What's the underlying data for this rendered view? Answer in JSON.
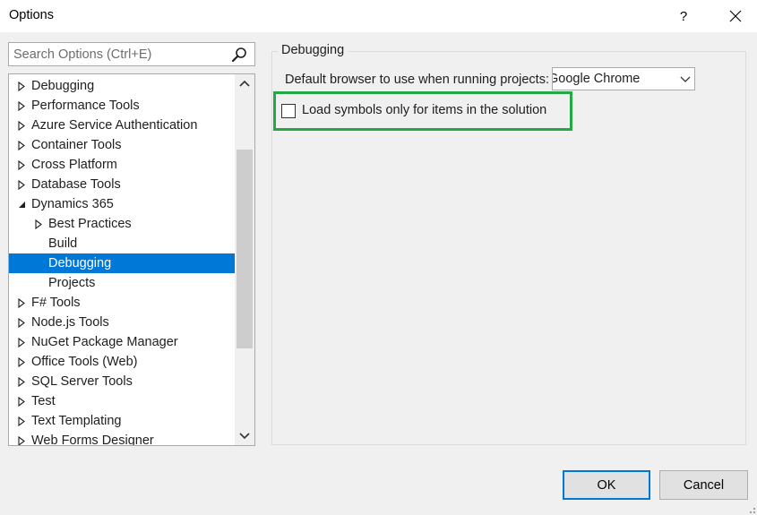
{
  "window": {
    "title": "Options",
    "help_label": "?"
  },
  "search": {
    "placeholder": "Search Options (Ctrl+E)",
    "icon": "magnifier-icon"
  },
  "tree": {
    "items": [
      {
        "label": "Debugging",
        "indent": 0,
        "arrow": "collapsed",
        "selected": false
      },
      {
        "label": "Performance Tools",
        "indent": 0,
        "arrow": "collapsed",
        "selected": false
      },
      {
        "label": "Azure Service Authentication",
        "indent": 0,
        "arrow": "collapsed",
        "selected": false
      },
      {
        "label": "Container Tools",
        "indent": 0,
        "arrow": "collapsed",
        "selected": false
      },
      {
        "label": "Cross Platform",
        "indent": 0,
        "arrow": "collapsed",
        "selected": false
      },
      {
        "label": "Database Tools",
        "indent": 0,
        "arrow": "collapsed",
        "selected": false
      },
      {
        "label": "Dynamics 365",
        "indent": 0,
        "arrow": "expanded",
        "selected": false
      },
      {
        "label": "Best Practices",
        "indent": 1,
        "arrow": "collapsed",
        "selected": false
      },
      {
        "label": "Build",
        "indent": 1,
        "arrow": "none",
        "selected": false
      },
      {
        "label": "Debugging",
        "indent": 1,
        "arrow": "none",
        "selected": true
      },
      {
        "label": "Projects",
        "indent": 1,
        "arrow": "none",
        "selected": false
      },
      {
        "label": "F# Tools",
        "indent": 0,
        "arrow": "collapsed",
        "selected": false
      },
      {
        "label": "Node.js Tools",
        "indent": 0,
        "arrow": "collapsed",
        "selected": false
      },
      {
        "label": "NuGet Package Manager",
        "indent": 0,
        "arrow": "collapsed",
        "selected": false
      },
      {
        "label": "Office Tools (Web)",
        "indent": 0,
        "arrow": "collapsed",
        "selected": false
      },
      {
        "label": "SQL Server Tools",
        "indent": 0,
        "arrow": "collapsed",
        "selected": false
      },
      {
        "label": "Test",
        "indent": 0,
        "arrow": "collapsed",
        "selected": false
      },
      {
        "label": "Text Templating",
        "indent": 0,
        "arrow": "collapsed",
        "selected": false
      },
      {
        "label": "Web Forms Designer",
        "indent": 0,
        "arrow": "collapsed",
        "selected": false
      }
    ]
  },
  "panel": {
    "group_title": "Debugging",
    "browser_label": "Default browser to use when running projects:",
    "browser_value": "Google Chrome",
    "load_symbols_label": "Load symbols only for items in the solution",
    "load_symbols_checked": false
  },
  "buttons": {
    "ok_label": "OK",
    "cancel_label": "Cancel"
  },
  "colors": {
    "selection": "#0078d7",
    "highlight_box": "#22a845",
    "window_bg": "#f0f0f0"
  }
}
